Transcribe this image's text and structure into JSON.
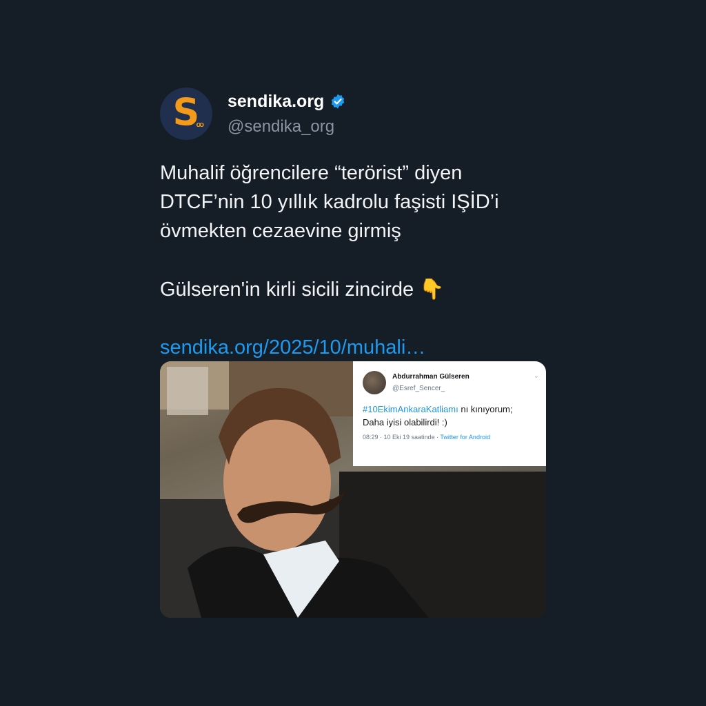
{
  "tweet": {
    "display_name": "sendika.org",
    "handle": "@sendika_org",
    "avatar_letter": "S",
    "avatar_dots": "oo",
    "lines": [
      "Muhalif öğrencilere “terörist” diyen",
      "DTCF’nin 10 yıllık kadrolu faşisti IŞİD’i",
      "övmekten cezaevine girmiş"
    ],
    "second_paragraph": "Gülseren'in kirli sicili zincirde",
    "emoji": "👇",
    "link": "sendika.org/2025/10/muhali…"
  },
  "embedded_tweet": {
    "name": "Abdurrahman Gülseren",
    "handle": "@Esref_Sencer_",
    "chevron": "⌄",
    "hashtag": "#10EkimAnkaraKatliamı",
    "text_rest": " nı kınıyorum;",
    "text_line2": "Daha iyisi olabilirdi! :)",
    "meta": "08:29 · 10 Eki 19 saatinde · ",
    "source": "Twitter for Android"
  },
  "colors": {
    "background": "#151d26",
    "link": "#1d9bf0",
    "verified": "#1d9bf0",
    "avatar_bg": "#1f2f4d",
    "avatar_accent": "#f39a1a"
  },
  "icons": {
    "verified": "verified-badge-icon"
  }
}
